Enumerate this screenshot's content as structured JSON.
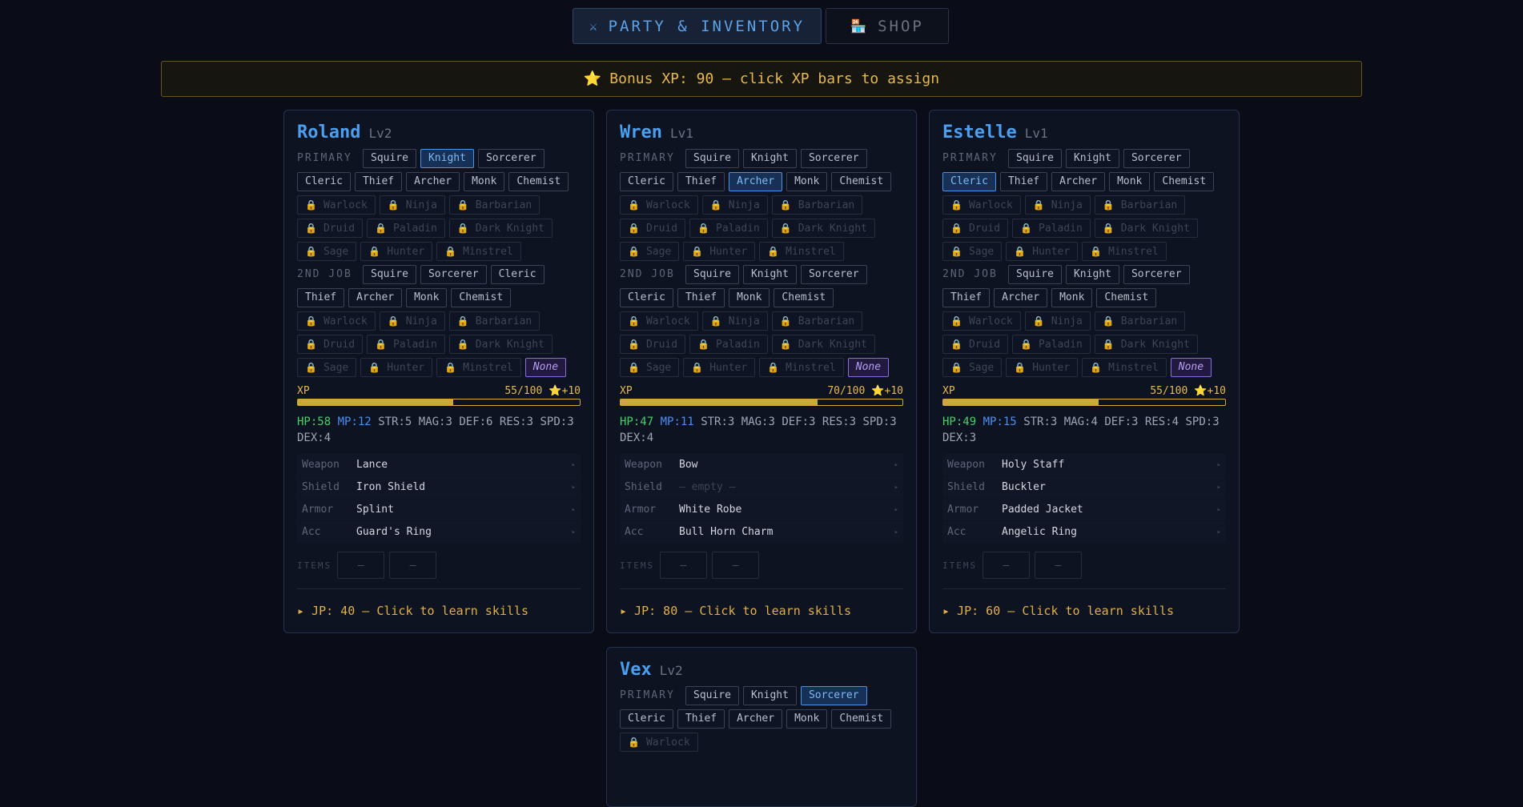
{
  "tabs": [
    {
      "icon": "⚔",
      "label": "PARTY & INVENTORY",
      "active": true
    },
    {
      "icon": "🏪",
      "label": "SHOP",
      "active": false
    }
  ],
  "banner": {
    "icon": "⭐",
    "text": "Bonus XP: 90 — click XP bars to assign"
  },
  "labels": {
    "primary": "PRIMARY",
    "second": "2ND JOB",
    "xp": "XP",
    "items": "ITEMS",
    "empty_slot": "—",
    "lock_icon": "🔒",
    "star": "⭐",
    "arrow": "▸"
  },
  "characters": [
    {
      "name": "Roland",
      "level": "Lv2",
      "primary": [
        {
          "label": "Squire"
        },
        {
          "label": "Knight",
          "state": "sel"
        },
        {
          "label": "Sorcerer"
        },
        {
          "label": "Cleric"
        },
        {
          "label": "Thief"
        },
        {
          "label": "Archer"
        },
        {
          "label": "Monk"
        },
        {
          "label": "Chemist"
        },
        {
          "label": "Warlock",
          "state": "lock"
        },
        {
          "label": "Ninja",
          "state": "lock"
        },
        {
          "label": "Barbarian",
          "state": "lock"
        },
        {
          "label": "Druid",
          "state": "lock"
        },
        {
          "label": "Paladin",
          "state": "lock"
        },
        {
          "label": "Dark Knight",
          "state": "lock"
        },
        {
          "label": "Sage",
          "state": "lock"
        },
        {
          "label": "Hunter",
          "state": "lock"
        },
        {
          "label": "Minstrel",
          "state": "lock"
        }
      ],
      "secondary": [
        {
          "label": "Squire"
        },
        {
          "label": "Sorcerer"
        },
        {
          "label": "Cleric"
        },
        {
          "label": "Thief"
        },
        {
          "label": "Archer"
        },
        {
          "label": "Monk"
        },
        {
          "label": "Chemist"
        },
        {
          "label": "Warlock",
          "state": "lock"
        },
        {
          "label": "Ninja",
          "state": "lock"
        },
        {
          "label": "Barbarian",
          "state": "lock"
        },
        {
          "label": "Druid",
          "state": "lock"
        },
        {
          "label": "Paladin",
          "state": "lock"
        },
        {
          "label": "Dark Knight",
          "state": "lock"
        },
        {
          "label": "Sage",
          "state": "lock"
        },
        {
          "label": "Hunter",
          "state": "lock"
        },
        {
          "label": "Minstrel",
          "state": "lock"
        },
        {
          "label": "None",
          "state": "none"
        }
      ],
      "xp_text": "55/100",
      "xp_fraction": 0.55,
      "xp_bonus": "+10",
      "stats": {
        "hp": "HP:58",
        "mp": "MP:12",
        "rest": "STR:5 MAG:3 DEF:6 RES:3 SPD:3 DEX:4"
      },
      "equipment": [
        {
          "slot": "Weapon",
          "item": "Lance"
        },
        {
          "slot": "Shield",
          "item": "Iron Shield"
        },
        {
          "slot": "Armor",
          "item": "Splint"
        },
        {
          "slot": "Acc",
          "item": "Guard's Ring"
        }
      ],
      "jp": "▸ JP: 40 — Click to learn skills"
    },
    {
      "name": "Wren",
      "level": "Lv1",
      "primary": [
        {
          "label": "Squire"
        },
        {
          "label": "Knight"
        },
        {
          "label": "Sorcerer"
        },
        {
          "label": "Cleric"
        },
        {
          "label": "Thief"
        },
        {
          "label": "Archer",
          "state": "sel"
        },
        {
          "label": "Monk"
        },
        {
          "label": "Chemist"
        },
        {
          "label": "Warlock",
          "state": "lock"
        },
        {
          "label": "Ninja",
          "state": "lock"
        },
        {
          "label": "Barbarian",
          "state": "lock"
        },
        {
          "label": "Druid",
          "state": "lock"
        },
        {
          "label": "Paladin",
          "state": "lock"
        },
        {
          "label": "Dark Knight",
          "state": "lock"
        },
        {
          "label": "Sage",
          "state": "lock"
        },
        {
          "label": "Hunter",
          "state": "lock"
        },
        {
          "label": "Minstrel",
          "state": "lock"
        }
      ],
      "secondary": [
        {
          "label": "Squire"
        },
        {
          "label": "Knight"
        },
        {
          "label": "Sorcerer"
        },
        {
          "label": "Cleric"
        },
        {
          "label": "Thief"
        },
        {
          "label": "Monk"
        },
        {
          "label": "Chemist"
        },
        {
          "label": "Warlock",
          "state": "lock"
        },
        {
          "label": "Ninja",
          "state": "lock"
        },
        {
          "label": "Barbarian",
          "state": "lock"
        },
        {
          "label": "Druid",
          "state": "lock"
        },
        {
          "label": "Paladin",
          "state": "lock"
        },
        {
          "label": "Dark Knight",
          "state": "lock"
        },
        {
          "label": "Sage",
          "state": "lock"
        },
        {
          "label": "Hunter",
          "state": "lock"
        },
        {
          "label": "Minstrel",
          "state": "lock"
        },
        {
          "label": "None",
          "state": "none"
        }
      ],
      "xp_text": "70/100",
      "xp_fraction": 0.7,
      "xp_bonus": "+10",
      "stats": {
        "hp": "HP:47",
        "mp": "MP:11",
        "rest": "STR:3 MAG:3 DEF:3 RES:3 SPD:3 DEX:4"
      },
      "equipment": [
        {
          "slot": "Weapon",
          "item": "Bow"
        },
        {
          "slot": "Shield",
          "item": "— empty —",
          "empty": true
        },
        {
          "slot": "Armor",
          "item": "White Robe"
        },
        {
          "slot": "Acc",
          "item": "Bull Horn Charm"
        }
      ],
      "jp": "▸ JP: 80 — Click to learn skills"
    },
    {
      "name": "Estelle",
      "level": "Lv1",
      "primary": [
        {
          "label": "Squire"
        },
        {
          "label": "Knight"
        },
        {
          "label": "Sorcerer"
        },
        {
          "label": "Cleric",
          "state": "sel"
        },
        {
          "label": "Thief"
        },
        {
          "label": "Archer"
        },
        {
          "label": "Monk"
        },
        {
          "label": "Chemist"
        },
        {
          "label": "Warlock",
          "state": "lock"
        },
        {
          "label": "Ninja",
          "state": "lock"
        },
        {
          "label": "Barbarian",
          "state": "lock"
        },
        {
          "label": "Druid",
          "state": "lock"
        },
        {
          "label": "Paladin",
          "state": "lock"
        },
        {
          "label": "Dark Knight",
          "state": "lock"
        },
        {
          "label": "Sage",
          "state": "lock"
        },
        {
          "label": "Hunter",
          "state": "lock"
        },
        {
          "label": "Minstrel",
          "state": "lock"
        }
      ],
      "secondary": [
        {
          "label": "Squire"
        },
        {
          "label": "Knight"
        },
        {
          "label": "Sorcerer"
        },
        {
          "label": "Thief"
        },
        {
          "label": "Archer"
        },
        {
          "label": "Monk"
        },
        {
          "label": "Chemist"
        },
        {
          "label": "Warlock",
          "state": "lock"
        },
        {
          "label": "Ninja",
          "state": "lock"
        },
        {
          "label": "Barbarian",
          "state": "lock"
        },
        {
          "label": "Druid",
          "state": "lock"
        },
        {
          "label": "Paladin",
          "state": "lock"
        },
        {
          "label": "Dark Knight",
          "state": "lock"
        },
        {
          "label": "Sage",
          "state": "lock"
        },
        {
          "label": "Hunter",
          "state": "lock"
        },
        {
          "label": "Minstrel",
          "state": "lock"
        },
        {
          "label": "None",
          "state": "none"
        }
      ],
      "xp_text": "55/100",
      "xp_fraction": 0.55,
      "xp_bonus": "+10",
      "stats": {
        "hp": "HP:49",
        "mp": "MP:15",
        "rest": "STR:3 MAG:4 DEF:3 RES:4 SPD:3 DEX:3"
      },
      "equipment": [
        {
          "slot": "Weapon",
          "item": "Holy Staff"
        },
        {
          "slot": "Shield",
          "item": "Buckler"
        },
        {
          "slot": "Armor",
          "item": "Padded Jacket"
        },
        {
          "slot": "Acc",
          "item": "Angelic Ring"
        }
      ],
      "jp": "▸ JP: 60 — Click to learn skills"
    },
    {
      "name": "Vex",
      "level": "Lv2",
      "primary": [
        {
          "label": "Squire"
        },
        {
          "label": "Knight"
        },
        {
          "label": "Sorcerer",
          "state": "sel"
        },
        {
          "label": "Cleric"
        },
        {
          "label": "Thief"
        },
        {
          "label": "Archer"
        },
        {
          "label": "Monk"
        },
        {
          "label": "Chemist"
        },
        {
          "label": "Warlock",
          "state": "lock"
        }
      ],
      "partial": true
    }
  ]
}
